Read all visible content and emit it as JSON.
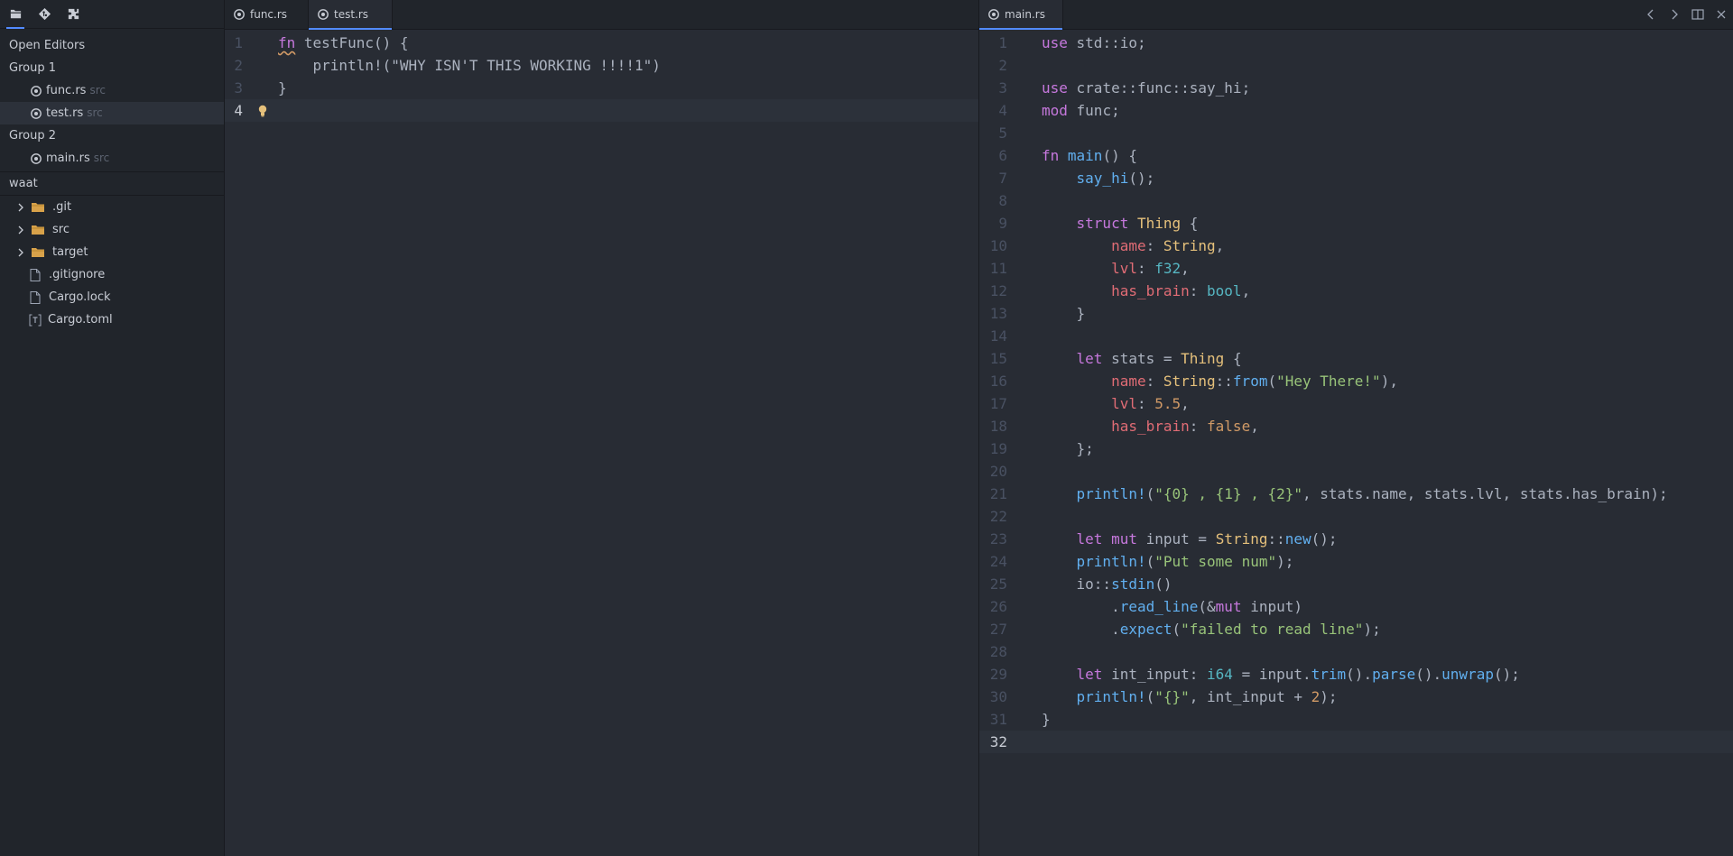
{
  "activity_bar": {
    "icons": [
      "files-icon",
      "git-icon",
      "extensions-icon"
    ]
  },
  "sidebar": {
    "open_editors_title": "Open Editors",
    "groups": [
      {
        "label": "Group 1",
        "files": [
          {
            "name": "func.rs",
            "desc": "src"
          },
          {
            "name": "test.rs",
            "desc": "src"
          }
        ]
      },
      {
        "label": "Group 2",
        "files": [
          {
            "name": "main.rs",
            "desc": "src"
          }
        ]
      }
    ],
    "project_title": "waat",
    "tree": [
      {
        "name": ".git",
        "type": "folder"
      },
      {
        "name": "src",
        "type": "folder"
      },
      {
        "name": "target",
        "type": "folder"
      },
      {
        "name": ".gitignore",
        "type": "file"
      },
      {
        "name": "Cargo.lock",
        "type": "file"
      },
      {
        "name": "Cargo.toml",
        "type": "toml"
      }
    ]
  },
  "left_pane": {
    "tabs": [
      {
        "label": "func.rs"
      },
      {
        "label": "test.rs",
        "active": true
      }
    ],
    "line_numbers": [
      "1",
      "2",
      "3",
      "4"
    ],
    "code": [
      [
        [
          "k",
          "fn"
        ],
        [
          "plain",
          " "
        ],
        [
          "plain",
          "testFunc() {"
        ]
      ],
      [
        [
          "plain",
          "    println!(\"WHY ISN'T THIS WORKING !!!!1\")"
        ]
      ],
      [
        [
          "plain",
          "}"
        ]
      ],
      []
    ]
  },
  "right_pane": {
    "tabs": [
      {
        "label": "main.rs",
        "active": true
      }
    ],
    "line_numbers": [
      "1",
      "2",
      "3",
      "4",
      "5",
      "6",
      "7",
      "8",
      "9",
      "10",
      "11",
      "12",
      "13",
      "14",
      "15",
      "16",
      "17",
      "18",
      "19",
      "20",
      "21",
      "22",
      "23",
      "24",
      "25",
      "26",
      "27",
      "28",
      "29",
      "30",
      "31",
      "32"
    ],
    "code": [
      [
        [
          "k",
          "use"
        ],
        [
          "plain",
          " std::io;"
        ]
      ],
      [],
      [
        [
          "k",
          "use"
        ],
        [
          "plain",
          " crate::func::say_hi;"
        ]
      ],
      [
        [
          "k",
          "mod"
        ],
        [
          "plain",
          " func;"
        ]
      ],
      [],
      [
        [
          "k",
          "fn"
        ],
        [
          "plain",
          " "
        ],
        [
          "f",
          "main"
        ],
        [
          "plain",
          "() {"
        ]
      ],
      [
        [
          "plain",
          "    "
        ],
        [
          "f",
          "say_hi"
        ],
        [
          "plain",
          "();"
        ]
      ],
      [],
      [
        [
          "plain",
          "    "
        ],
        [
          "k",
          "struct"
        ],
        [
          "plain",
          " "
        ],
        [
          "t",
          "Thing"
        ],
        [
          "plain",
          " {"
        ]
      ],
      [
        [
          "plain",
          "        "
        ],
        [
          "p",
          "name"
        ],
        [
          "plain",
          ": "
        ],
        [
          "t",
          "String"
        ],
        [
          "plain",
          ","
        ]
      ],
      [
        [
          "plain",
          "        "
        ],
        [
          "p",
          "lvl"
        ],
        [
          "plain",
          ": "
        ],
        [
          "b",
          "f32"
        ],
        [
          "plain",
          ","
        ]
      ],
      [
        [
          "plain",
          "        "
        ],
        [
          "p",
          "has_brain"
        ],
        [
          "plain",
          ": "
        ],
        [
          "b",
          "bool"
        ],
        [
          "plain",
          ","
        ]
      ],
      [
        [
          "plain",
          "    }"
        ]
      ],
      [],
      [
        [
          "plain",
          "    "
        ],
        [
          "k",
          "let"
        ],
        [
          "plain",
          " stats = "
        ],
        [
          "t",
          "Thing"
        ],
        [
          "plain",
          " {"
        ]
      ],
      [
        [
          "plain",
          "        "
        ],
        [
          "p",
          "name"
        ],
        [
          "plain",
          ": "
        ],
        [
          "t",
          "String"
        ],
        [
          "plain",
          "::"
        ],
        [
          "f",
          "from"
        ],
        [
          "plain",
          "("
        ],
        [
          "s",
          "\"Hey There!\""
        ],
        [
          "plain",
          "),"
        ]
      ],
      [
        [
          "plain",
          "        "
        ],
        [
          "p",
          "lvl"
        ],
        [
          "plain",
          ": "
        ],
        [
          "n",
          "5.5"
        ],
        [
          "plain",
          ","
        ]
      ],
      [
        [
          "plain",
          "        "
        ],
        [
          "p",
          "has_brain"
        ],
        [
          "plain",
          ": "
        ],
        [
          "n",
          "false"
        ],
        [
          "plain",
          ","
        ]
      ],
      [
        [
          "plain",
          "    };"
        ]
      ],
      [],
      [
        [
          "plain",
          "    "
        ],
        [
          "f",
          "println!"
        ],
        [
          "plain",
          "("
        ],
        [
          "s",
          "\"{0} , {1} , {2}\""
        ],
        [
          "plain",
          ", stats.name, stats.lvl, stats.has_brain);"
        ]
      ],
      [],
      [
        [
          "plain",
          "    "
        ],
        [
          "k",
          "let"
        ],
        [
          "plain",
          " "
        ],
        [
          "k",
          "mut"
        ],
        [
          "plain",
          " input = "
        ],
        [
          "t",
          "String"
        ],
        [
          "plain",
          "::"
        ],
        [
          "f",
          "new"
        ],
        [
          "plain",
          "();"
        ]
      ],
      [
        [
          "plain",
          "    "
        ],
        [
          "f",
          "println!"
        ],
        [
          "plain",
          "("
        ],
        [
          "s",
          "\"Put some num\""
        ],
        [
          "plain",
          ");"
        ]
      ],
      [
        [
          "plain",
          "    io::"
        ],
        [
          "f",
          "stdin"
        ],
        [
          "plain",
          "()"
        ]
      ],
      [
        [
          "plain",
          "        ."
        ],
        [
          "f",
          "read_line"
        ],
        [
          "plain",
          "(&"
        ],
        [
          "k",
          "mut"
        ],
        [
          "plain",
          " input)"
        ]
      ],
      [
        [
          "plain",
          "        ."
        ],
        [
          "f",
          "expect"
        ],
        [
          "plain",
          "("
        ],
        [
          "s",
          "\"failed to read line\""
        ],
        [
          "plain",
          ");"
        ]
      ],
      [],
      [
        [
          "plain",
          "    "
        ],
        [
          "k",
          "let"
        ],
        [
          "plain",
          " int_input: "
        ],
        [
          "b",
          "i64"
        ],
        [
          "plain",
          " = input."
        ],
        [
          "f",
          "trim"
        ],
        [
          "plain",
          "()."
        ],
        [
          "f",
          "parse"
        ],
        [
          "plain",
          "()."
        ],
        [
          "f",
          "unwrap"
        ],
        [
          "plain",
          "();"
        ]
      ],
      [
        [
          "plain",
          "    "
        ],
        [
          "f",
          "println!"
        ],
        [
          "plain",
          "("
        ],
        [
          "s",
          "\"{}\""
        ],
        [
          "plain",
          ", int_input + "
        ],
        [
          "n",
          "2"
        ],
        [
          "plain",
          ");"
        ]
      ],
      [
        [
          "plain",
          "}"
        ]
      ],
      []
    ]
  },
  "colors": {
    "accent": "#528bff",
    "keyword": "#c678dd",
    "function": "#61afef",
    "type": "#e5c07b",
    "property": "#e06c75",
    "string": "#98c379",
    "number": "#d19a66",
    "builtin": "#56b6c2"
  }
}
